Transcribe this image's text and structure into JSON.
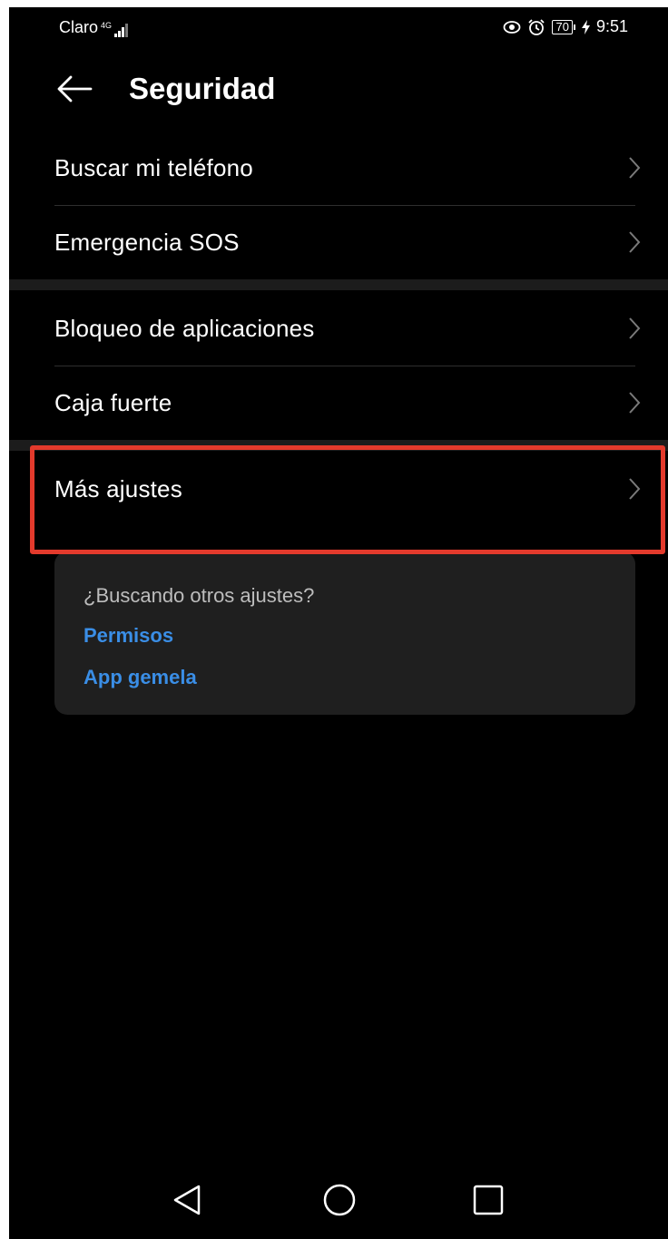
{
  "status_bar": {
    "carrier": "Claro",
    "network_type": "4G",
    "battery_level": "70",
    "time": "9:51"
  },
  "header": {
    "title": "Seguridad"
  },
  "groups": [
    {
      "items": [
        {
          "label": "Buscar mi teléfono"
        },
        {
          "label": "Emergencia SOS"
        }
      ]
    },
    {
      "items": [
        {
          "label": "Bloqueo de aplicaciones"
        },
        {
          "label": "Caja fuerte"
        }
      ]
    },
    {
      "items": [
        {
          "label": "Más ajustes"
        }
      ]
    }
  ],
  "suggestion_card": {
    "title": "¿Buscando otros ajustes?",
    "links": [
      {
        "label": "Permisos"
      },
      {
        "label": "App gemela"
      }
    ]
  },
  "colors": {
    "background": "#000000",
    "link": "#3a8ee6",
    "highlight": "#e33a2c",
    "card": "#1f1f1f"
  },
  "nav_bar": {
    "icons": [
      "back-triangle-icon",
      "home-circle-icon",
      "recents-square-icon"
    ]
  }
}
